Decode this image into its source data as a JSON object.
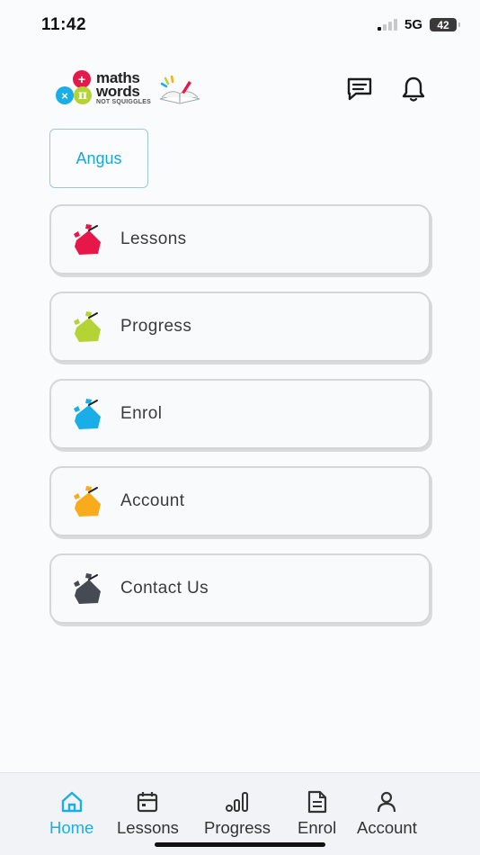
{
  "status_bar": {
    "time": "11:42",
    "network": "5G",
    "battery": "42"
  },
  "header": {
    "logo": {
      "line1": "maths",
      "line2": "words",
      "tagline": "NOT SQUIGGLES",
      "badges": [
        "+",
        "×",
        "π"
      ]
    },
    "icons": [
      "message-icon",
      "bell-icon"
    ]
  },
  "student": {
    "name": "Angus"
  },
  "menu": {
    "items": [
      {
        "label": "Lessons",
        "color": "#e8174a"
      },
      {
        "label": "Progress",
        "color": "#b5d334"
      },
      {
        "label": "Enrol",
        "color": "#1aaee8"
      },
      {
        "label": "Account",
        "color": "#f8ac1b"
      },
      {
        "label": "Contact Us",
        "color": "#464a52"
      }
    ]
  },
  "bottom_nav": {
    "active_color": "#19aee6",
    "items": [
      {
        "label": "Home",
        "icon": "home-icon",
        "active": true
      },
      {
        "label": "Lessons",
        "icon": "calendar-icon",
        "active": false
      },
      {
        "label": "Progress",
        "icon": "bar-chart-icon",
        "active": false
      },
      {
        "label": "Enrol",
        "icon": "document-icon",
        "active": false
      },
      {
        "label": "Account",
        "icon": "user-icon",
        "active": false
      }
    ]
  }
}
